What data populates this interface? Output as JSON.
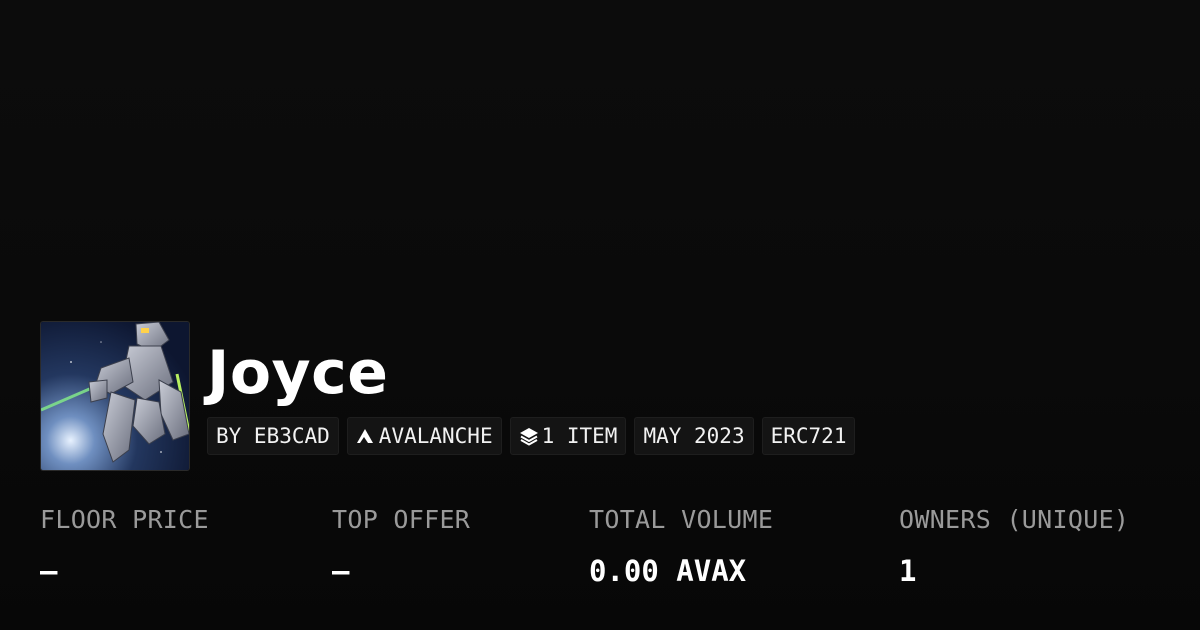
{
  "collection": {
    "name": "Joyce",
    "avatar_alt": "robot-artwork"
  },
  "badges": [
    {
      "label": "BY EB3CAD",
      "icon": ""
    },
    {
      "label": "AVALANCHE",
      "icon": "avalanche-icon"
    },
    {
      "label": "1 ITEM",
      "icon": "layers-icon"
    },
    {
      "label": "MAY 2023",
      "icon": ""
    },
    {
      "label": "ERC721",
      "icon": ""
    }
  ],
  "stats": [
    {
      "label": "FLOOR PRICE",
      "value": "–"
    },
    {
      "label": "TOP OFFER",
      "value": "–"
    },
    {
      "label": "TOTAL VOLUME",
      "value": "0.00 AVAX"
    },
    {
      "label": "OWNERS (UNIQUE)",
      "value": "1"
    }
  ],
  "colors": {
    "background": "#0a0a0a",
    "badge_background": "#141414",
    "label_gray": "#9a9a9a",
    "text": "#ffffff"
  }
}
